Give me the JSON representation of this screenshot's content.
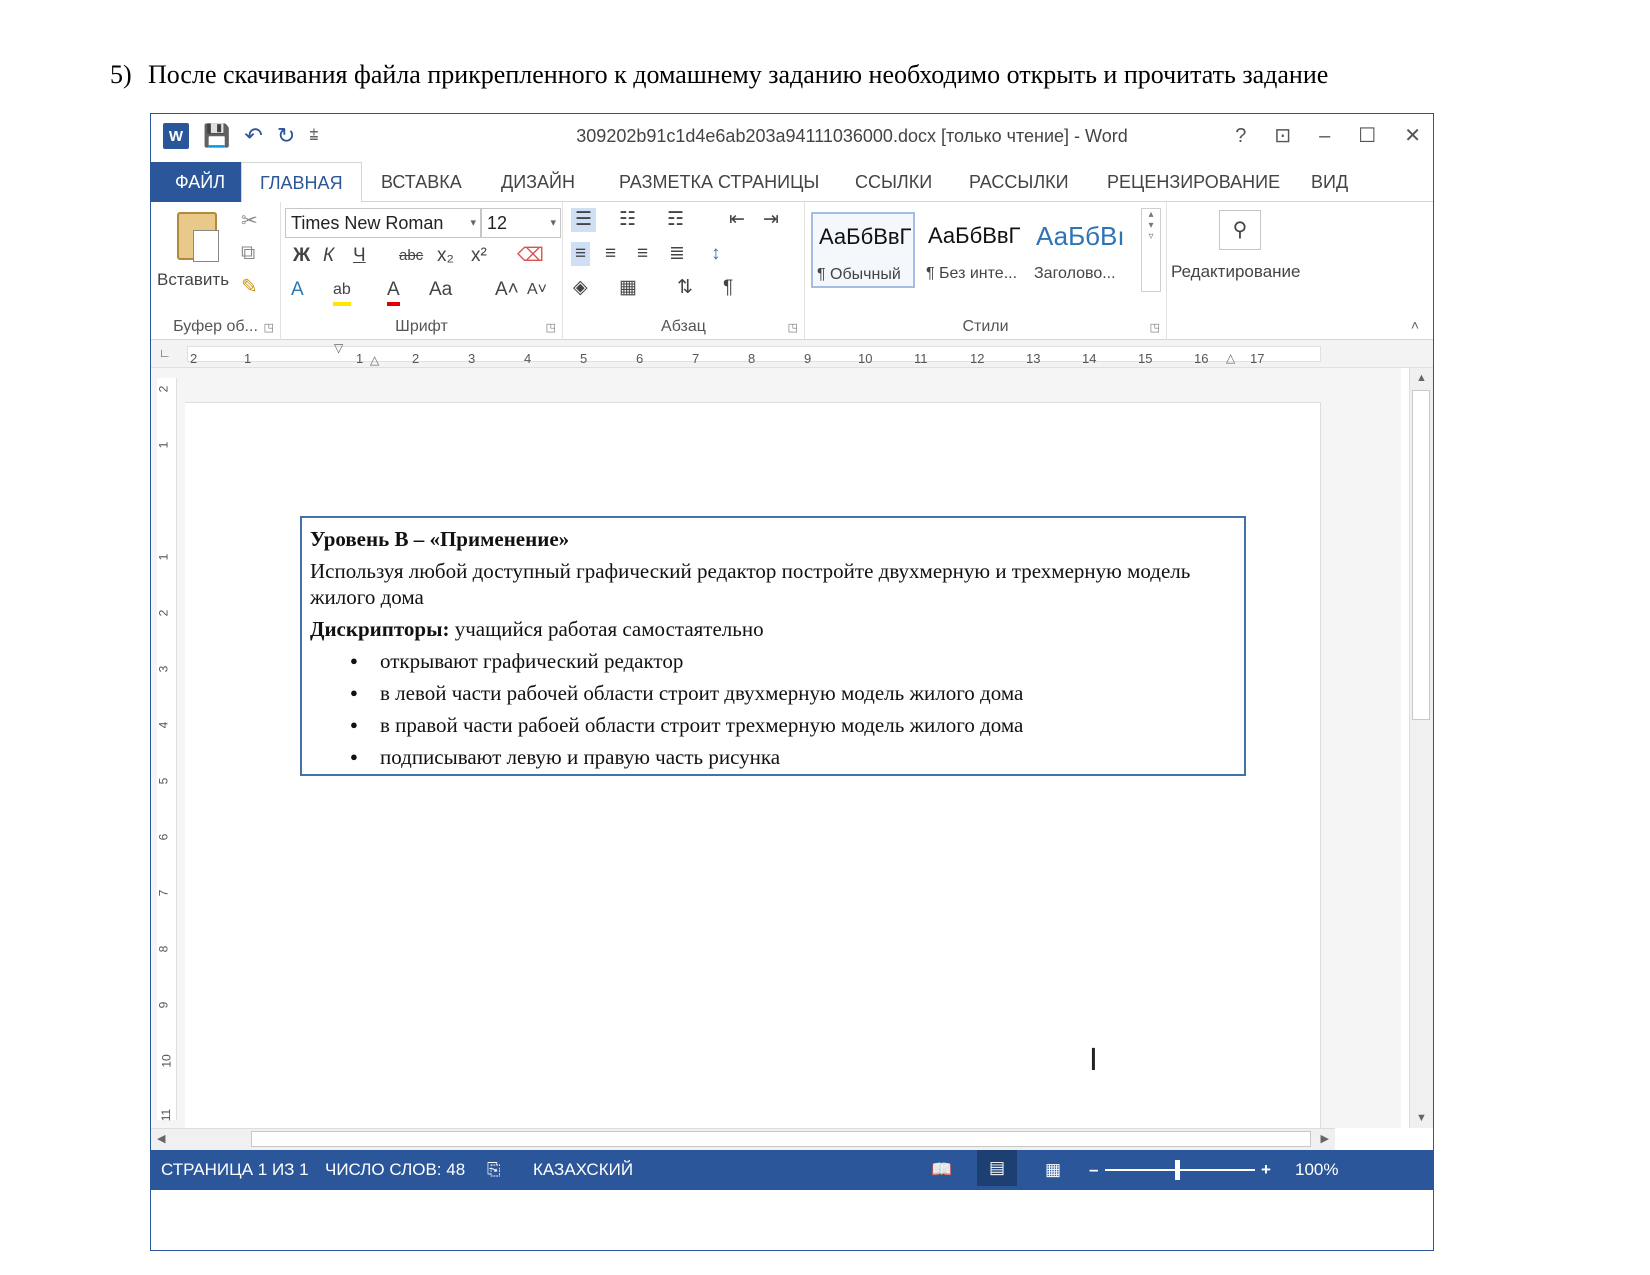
{
  "caption": {
    "number": "5)",
    "text": "После скачивания файла прикрепленного к домашнему заданию необходимо открыть и прочитать задание"
  },
  "window": {
    "title": "309202b91c1d4e6ab203a94111036000.docx [только чтение] - Word",
    "controls": {
      "help": "?",
      "ribbon_options": "⊡",
      "minimize": "–",
      "maximize": "☐",
      "close": "✕"
    }
  },
  "quick_access": {
    "save_icon": "💾",
    "undo_icon": "↶",
    "redo_icon": "↻",
    "customize_icon": "⩲"
  },
  "tabs": [
    {
      "label": "ФАЙЛ"
    },
    {
      "label": "ГЛАВНАЯ"
    },
    {
      "label": "ВСТАВКА"
    },
    {
      "label": "ДИЗАЙН"
    },
    {
      "label": "РАЗМЕТКА СТРАНИЦЫ"
    },
    {
      "label": "ССЫЛКИ"
    },
    {
      "label": "РАССЫЛКИ"
    },
    {
      "label": "РЕЦЕНЗИРОВАНИЕ"
    },
    {
      "label": "ВИД"
    }
  ],
  "ribbon": {
    "clipboard": {
      "paste_label": "Вставить",
      "group_label": "Буфер об..."
    },
    "font": {
      "font_name": "Times New Roman",
      "font_size": "12",
      "group_label": "Шрифт",
      "bold": "Ж",
      "italic": "К",
      "underline": "Ч",
      "strike": "abc",
      "subscript": "x₂",
      "superscript": "x²",
      "text_effects": "A",
      "highlight": "ab",
      "font_color": "A",
      "change_case": "Aa",
      "grow": "A˄",
      "shrink": "A˅"
    },
    "paragraph": {
      "group_label": "Абзац",
      "pilcrow": "¶"
    },
    "styles": {
      "group_label": "Стили",
      "items": [
        {
          "sample": "АаБбВвГ",
          "name": "¶ Обычный"
        },
        {
          "sample": "АаБбВвГ",
          "name": "¶ Без инте..."
        },
        {
          "sample": "АаБбВı",
          "name": "Заголово..."
        }
      ]
    },
    "editing": {
      "label": "Редактирование"
    }
  },
  "ruler": {
    "numbers": [
      "2",
      "1",
      "1",
      "2",
      "3",
      "4",
      "5",
      "6",
      "7",
      "8",
      "9",
      "10",
      "11",
      "12",
      "13",
      "14",
      "15",
      "16",
      "17"
    ],
    "vertical_numbers": [
      "2",
      "1",
      "1",
      "2",
      "3",
      "4",
      "5",
      "6",
      "7",
      "8",
      "9",
      "10",
      "11"
    ]
  },
  "document": {
    "heading": "Уровень В – «Применение»",
    "task": "Используя любой доступный графический редактор постройте двухмерную и трехмерную модель жилого дома",
    "descriptors_label": "Дискрипторы:",
    "descriptors_text": " учащийся работая самостаятельно",
    "bullets": [
      "открывают графический редактор",
      "в левой части рабочей области строит  двухмерную модель жилого дома",
      "в правой части рабоей области строит трехмерную модель жилого дома",
      "подписывают левую и правую часть рисунка"
    ]
  },
  "status": {
    "page": "СТРАНИЦА 1 ИЗ 1",
    "words": "ЧИСЛО СЛОВ: 48",
    "language": "КАЗАХСКИЙ",
    "zoom": "100%",
    "zoom_minus": "–",
    "zoom_plus": "+"
  }
}
